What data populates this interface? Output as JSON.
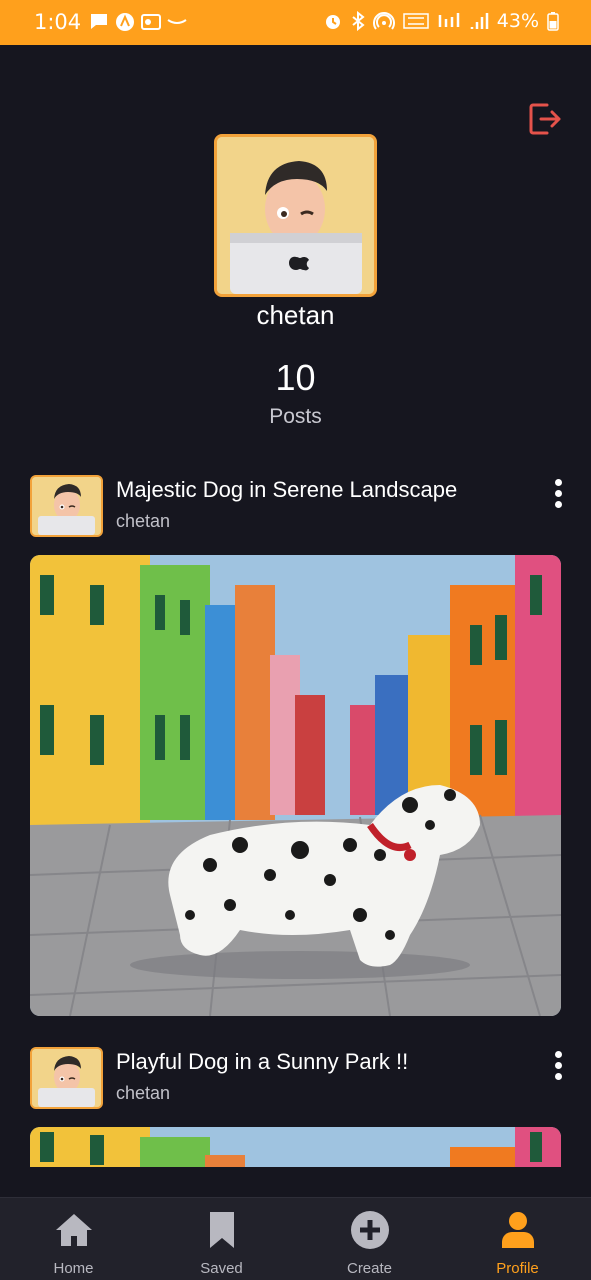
{
  "status_bar": {
    "time": "1:04",
    "battery": "43%",
    "background_color": "#ffa01c"
  },
  "profile": {
    "username": "chetan",
    "post_count": "10",
    "post_count_label": "Posts",
    "accent_color": "#f2a23a",
    "logout_color": "#e5534b"
  },
  "posts": [
    {
      "title": "Majestic Dog in Serene Landscape",
      "author": "chetan"
    },
    {
      "title": "Playful Dog in a Sunny Park !!",
      "author": "chetan"
    }
  ],
  "nav": {
    "items": [
      {
        "label": "Home",
        "icon": "home-icon"
      },
      {
        "label": "Saved",
        "icon": "bookmark-icon"
      },
      {
        "label": "Create",
        "icon": "plus-circle-icon"
      },
      {
        "label": "Profile",
        "icon": "person-icon"
      }
    ],
    "active_color": "#ffa01c"
  }
}
